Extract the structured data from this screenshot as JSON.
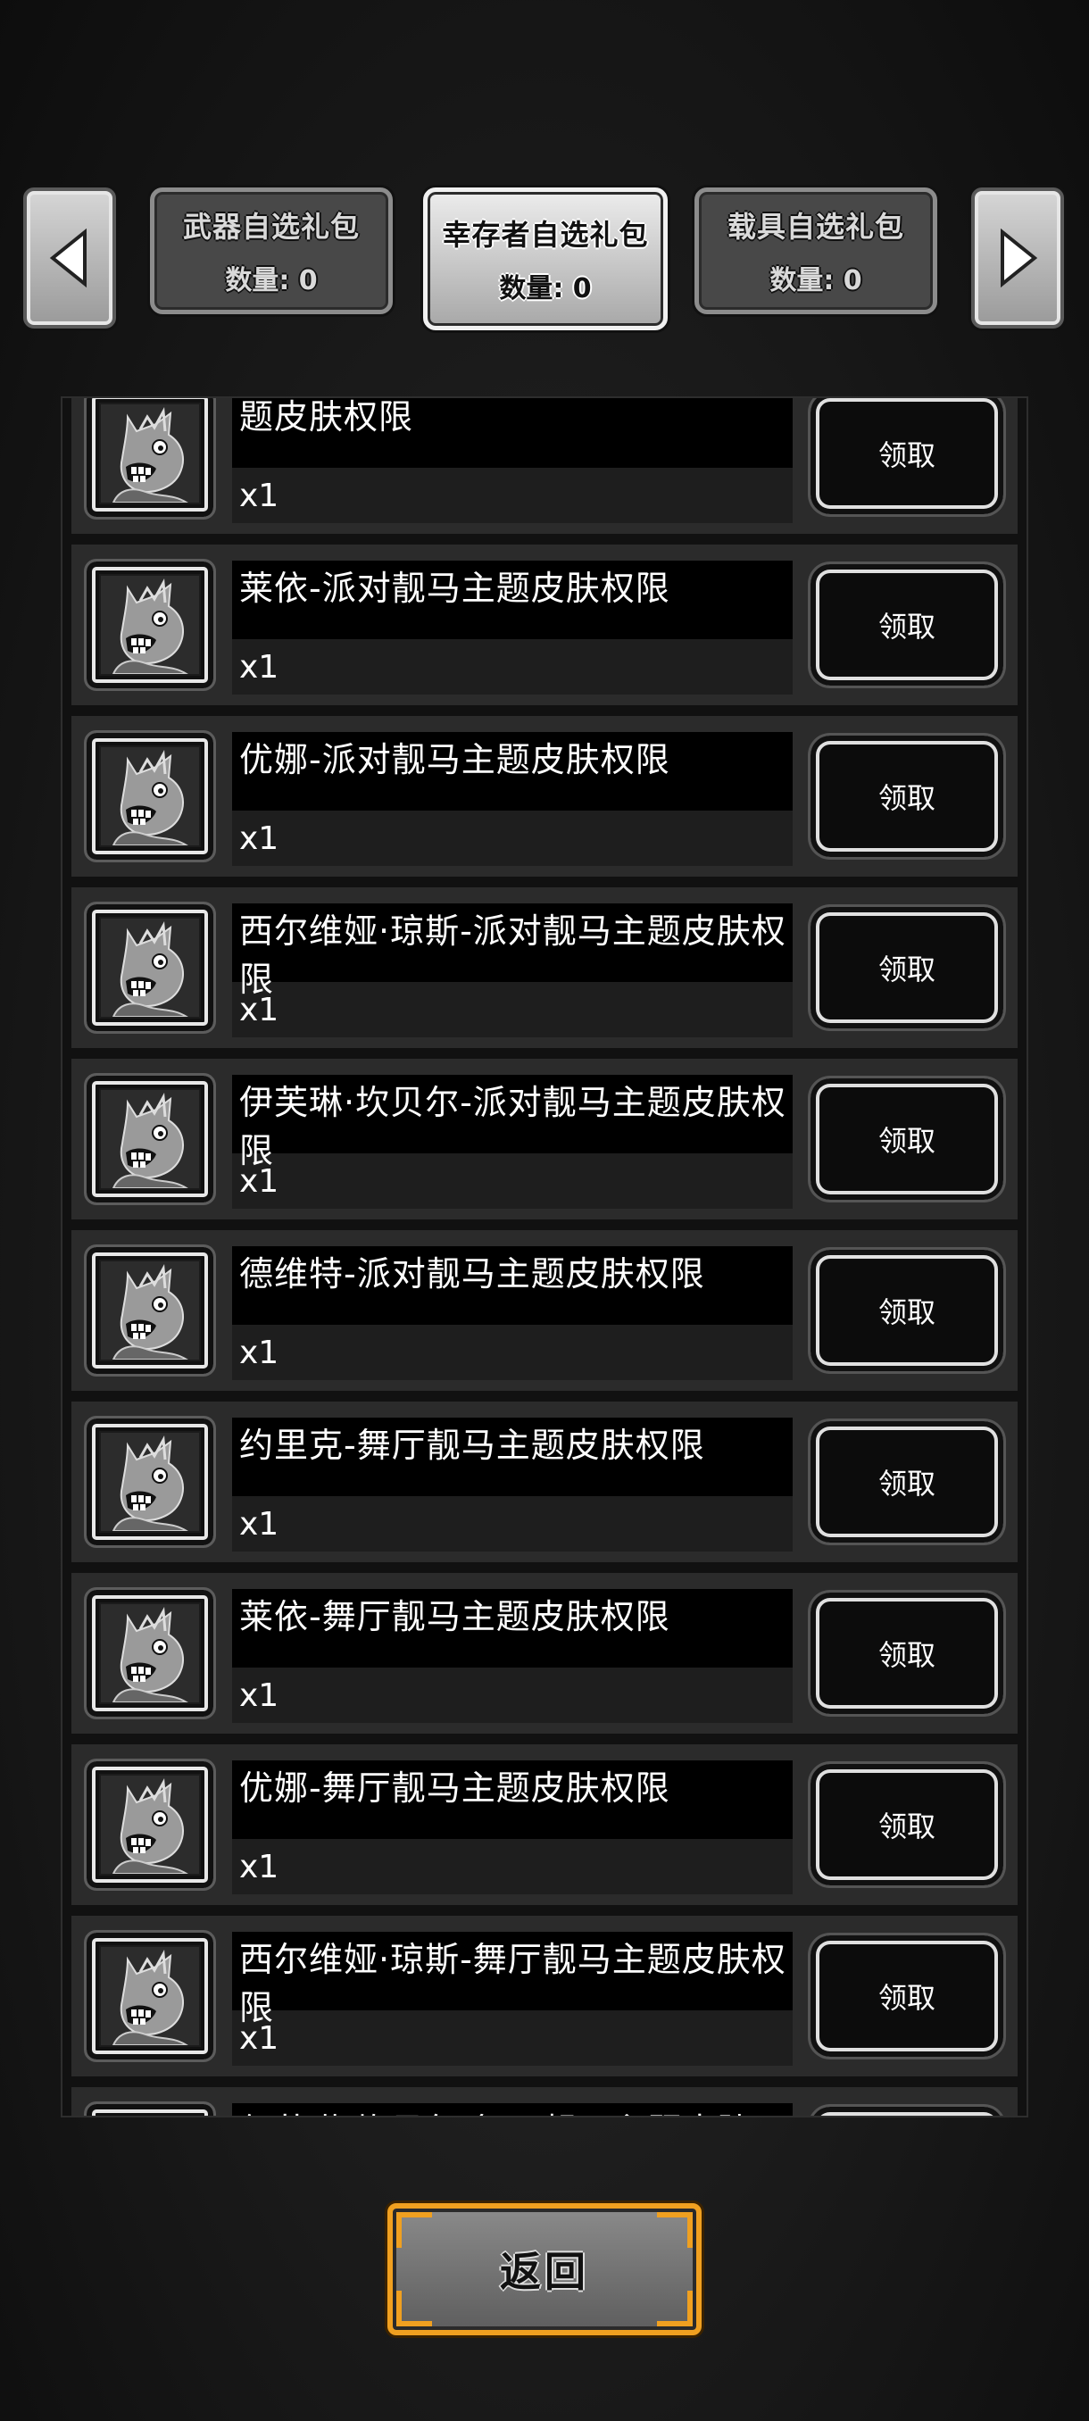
{
  "nav": {
    "prev_icon": "chevron-left-icon",
    "next_icon": "chevron-right-icon"
  },
  "tabs": [
    {
      "title": "武器自选礼包",
      "count": "数量: 0",
      "active": false
    },
    {
      "title": "幸存者自选礼包",
      "count": "数量: 0",
      "active": true
    },
    {
      "title": "载具自选礼包",
      "count": "数量: 0",
      "active": false
    }
  ],
  "rows": [
    {
      "name": "题皮肤权限",
      "qty": "x1",
      "button": "领取"
    },
    {
      "name": "莱依-派对靓马主题皮肤权限",
      "qty": "x1",
      "button": "领取"
    },
    {
      "name": "优娜-派对靓马主题皮肤权限",
      "qty": "x1",
      "button": "领取"
    },
    {
      "name": "西尔维娅·琼斯-派对靓马主题皮肤权限",
      "qty": "x1",
      "button": "领取"
    },
    {
      "name": "伊芙琳·坎贝尔-派对靓马主题皮肤权限",
      "qty": "x1",
      "button": "领取"
    },
    {
      "name": "德维特-派对靓马主题皮肤权限",
      "qty": "x1",
      "button": "领取"
    },
    {
      "name": "约里克-舞厅靓马主题皮肤权限",
      "qty": "x1",
      "button": "领取"
    },
    {
      "name": "莱依-舞厅靓马主题皮肤权限",
      "qty": "x1",
      "button": "领取"
    },
    {
      "name": "优娜-舞厅靓马主题皮肤权限",
      "qty": "x1",
      "button": "领取"
    },
    {
      "name": "西尔维娅·琼斯-舞厅靓马主题皮肤权限",
      "qty": "x1",
      "button": "领取"
    },
    {
      "name": "伊芙琳·坎贝尔-舞厅靓马主题皮肤",
      "qty": "",
      "button": ""
    }
  ],
  "avatar_icon": "horse-mask-icon",
  "back_button": {
    "label": "返回"
  },
  "colors": {
    "accent_gold": "#f0a020",
    "panel": "#2b2b2b",
    "name_band": "#000000"
  }
}
